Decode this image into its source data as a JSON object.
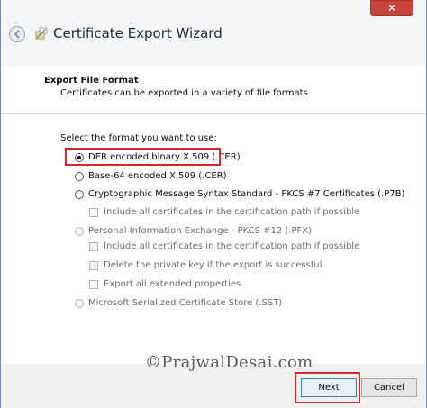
{
  "window": {
    "title": "Certificate Export Wizard",
    "close_glyph": "✕"
  },
  "icons": {
    "back": "back-arrow-icon",
    "wizard": "certificate-wizard-icon",
    "close": "close-icon"
  },
  "page": {
    "section_title": "Export File Format",
    "section_desc": "Certificates can be exported in a variety of file formats.",
    "select_label": "Select the format you want to use:"
  },
  "options": [
    {
      "label": "DER encoded binary X.509 (.CER)",
      "type": "radio",
      "checked": true,
      "enabled": true
    },
    {
      "label": "Base-64 encoded X.509 (.CER)",
      "type": "radio",
      "checked": false,
      "enabled": true
    },
    {
      "label": "Cryptographic Message Syntax Standard - PKCS #7 Certificates (.P7B)",
      "type": "radio",
      "checked": false,
      "enabled": true
    },
    {
      "label": "Include all certificates in the certification path if possible",
      "type": "checkbox",
      "checked": false,
      "enabled": false
    },
    {
      "label": "Personal Information Exchange - PKCS #12 (.PFX)",
      "type": "radio",
      "checked": false,
      "enabled": false
    },
    {
      "label": "Include all certificates in the certification path if possible",
      "type": "checkbox",
      "checked": false,
      "enabled": false
    },
    {
      "label": "Delete the private key if the export is successful",
      "type": "checkbox",
      "checked": false,
      "enabled": false
    },
    {
      "label": "Export all extended properties",
      "type": "checkbox",
      "checked": false,
      "enabled": false
    },
    {
      "label": "Microsoft Serialized Certificate Store (.SST)",
      "type": "radio",
      "checked": false,
      "enabled": false
    }
  ],
  "watermark": "©PrajwalDesai.com",
  "buttons": {
    "next": "Next",
    "cancel": "Cancel"
  },
  "colors": {
    "highlight": "#d6282c",
    "close": "#c7443a"
  }
}
